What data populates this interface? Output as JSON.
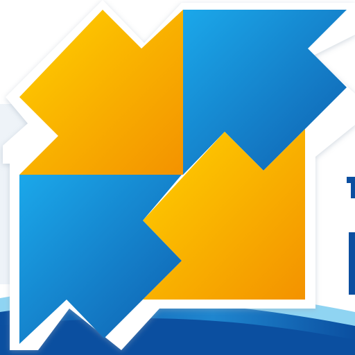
{
  "logo": {
    "icon": "four-arrows-quadrant-logo-icon",
    "colors": {
      "orange_light": "#FFD100",
      "orange_dark": "#F39200",
      "blue_light": "#1BA8EA",
      "blue_dark": "#0F5FAF",
      "background": "#FFFFFF",
      "outline": "#FFFFFF",
      "wave_dark": "#0B4FA0",
      "wave_light": "#8FD4F2"
    }
  }
}
